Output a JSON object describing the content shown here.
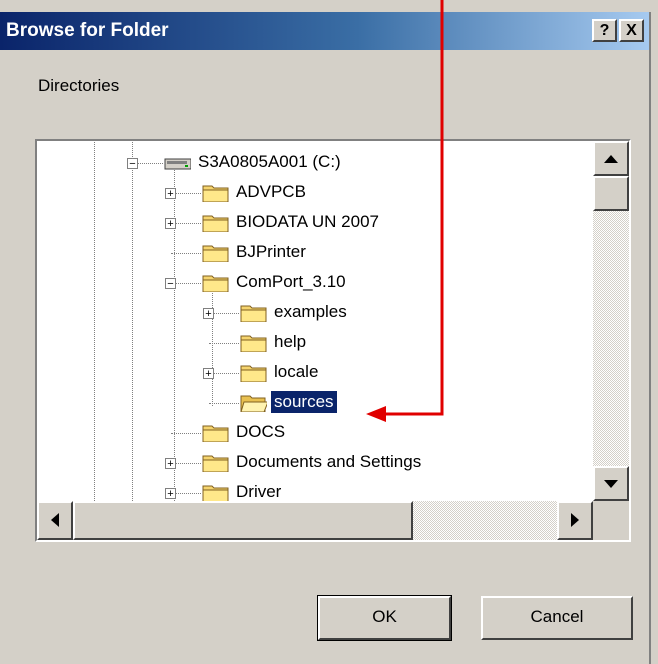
{
  "window": {
    "title": "Browse for Folder",
    "help_glyph": "?",
    "close_glyph": "X"
  },
  "directories_label": "Directories",
  "tree": {
    "items": [
      {
        "label": "S3A0805A001 (C:)",
        "icon": "drive-icon",
        "expander": "minus"
      },
      {
        "label": "ADVPCB",
        "icon": "folder-icon",
        "expander": "plus"
      },
      {
        "label": "BIODATA UN 2007",
        "icon": "folder-icon",
        "expander": "plus"
      },
      {
        "label": "BJPrinter",
        "icon": "folder-icon",
        "expander": "none"
      },
      {
        "label": "ComPort_3.10",
        "icon": "folder-icon",
        "expander": "minus"
      },
      {
        "label": "examples",
        "icon": "folder-icon",
        "expander": "plus"
      },
      {
        "label": "help",
        "icon": "folder-icon",
        "expander": "none"
      },
      {
        "label": "locale",
        "icon": "folder-icon",
        "expander": "plus"
      },
      {
        "label": "sources",
        "icon": "open-folder-icon",
        "expander": "none",
        "selected": true
      },
      {
        "label": "DOCS",
        "icon": "folder-icon",
        "expander": "none"
      },
      {
        "label": "Documents and Settings",
        "icon": "folder-icon",
        "expander": "plus"
      },
      {
        "label": "Driver",
        "icon": "folder-icon",
        "expander": "plus"
      }
    ]
  },
  "buttons": {
    "ok": "OK",
    "cancel": "Cancel"
  },
  "colors": {
    "annotation": "#e00000",
    "selection": "#0a246a",
    "folder": "#f5d46e"
  }
}
